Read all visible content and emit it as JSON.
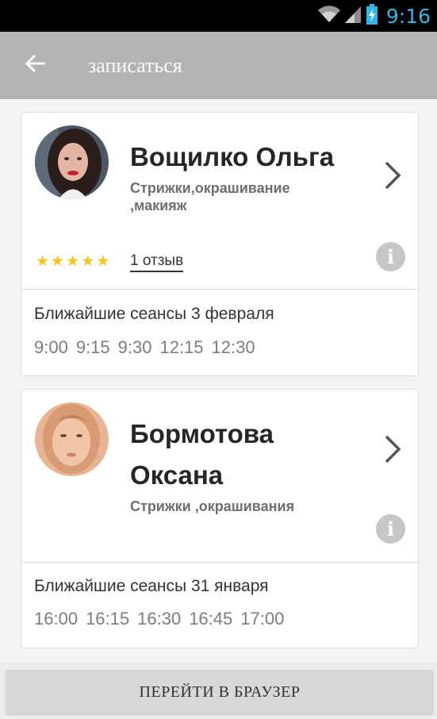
{
  "status_bar": {
    "time": "9:16",
    "icons": [
      "wifi-icon",
      "signal-icon",
      "battery-charging-icon"
    ]
  },
  "app_bar": {
    "title": "записаться",
    "back_icon": "arrow-left-icon"
  },
  "masters": [
    {
      "name": "Вощилко Ольга",
      "services": "Стрижки,окрашивание ,макияж",
      "rating": 5,
      "reviews": "1 отзыв",
      "sessions_label": "Ближайшие сеансы 3 февраля",
      "slots": [
        "9:00",
        "9:15",
        "9:30",
        "12:15",
        "12:30"
      ]
    },
    {
      "name_line1": "Бормотова",
      "name_line2": "Оксана",
      "services": "Стрижки ,окрашивания",
      "sessions_label": "Ближайшие сеансы 31 января",
      "slots": [
        "16:00",
        "16:15",
        "16:30",
        "16:45",
        "17:00"
      ]
    }
  ],
  "footer": {
    "browser_button": "ПЕРЕЙТИ В БРАУЗЕР"
  },
  "colors": {
    "accent_time": "#33b5e5",
    "star": "#f5c518",
    "app_bar": "#b3b3b3"
  }
}
